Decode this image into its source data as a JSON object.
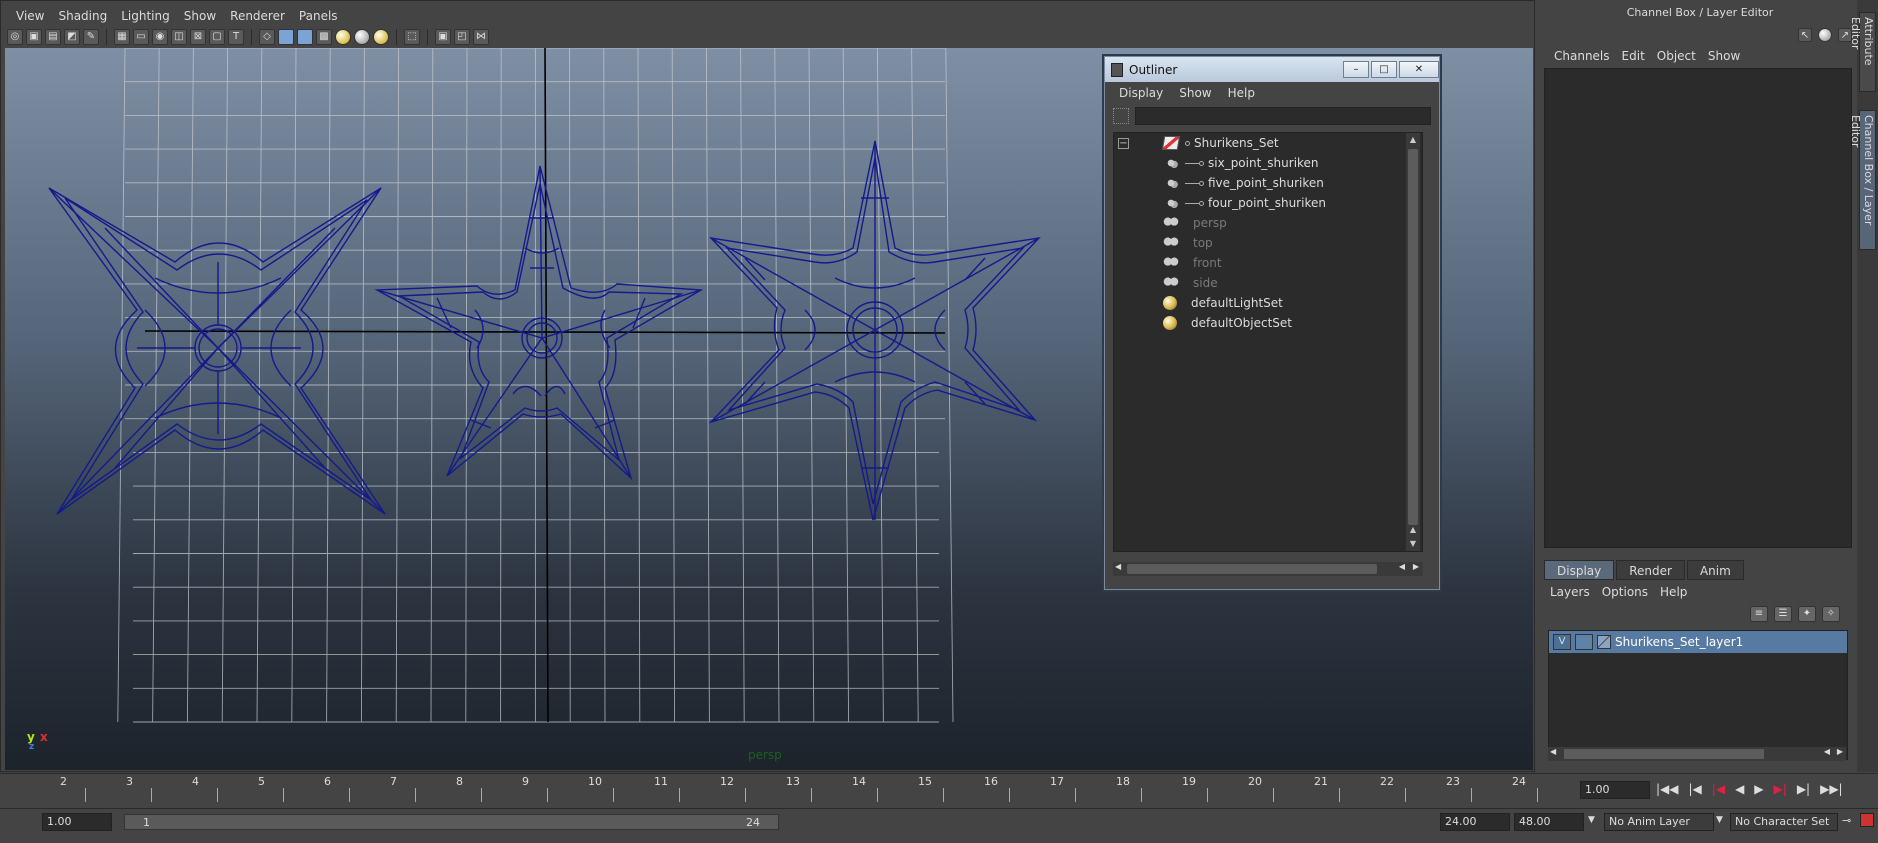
{
  "viewport": {
    "menu": [
      "View",
      "Shading",
      "Lighting",
      "Show",
      "Renderer",
      "Panels"
    ],
    "camera_label": "persp",
    "axis": {
      "y": "y",
      "x": "x",
      "z": "z"
    }
  },
  "outliner": {
    "title": "Outliner",
    "menu": [
      "Display",
      "Show",
      "Help"
    ],
    "filter_value": "",
    "items": [
      {
        "label": "Shurikens_Set",
        "icon": "set-icon",
        "level": 0,
        "expanded": true
      },
      {
        "label": "six_point_shuriken",
        "icon": "mesh-icon",
        "level": 1
      },
      {
        "label": "five_point_shuriken",
        "icon": "mesh-icon",
        "level": 1
      },
      {
        "label": "four_point_shuriken",
        "icon": "mesh-icon",
        "level": 1
      },
      {
        "label": "persp",
        "icon": "camera-icon",
        "level": 0,
        "dim": true
      },
      {
        "label": "top",
        "icon": "camera-icon",
        "level": 0,
        "dim": true
      },
      {
        "label": "front",
        "icon": "camera-icon",
        "level": 0,
        "dim": true
      },
      {
        "label": "side",
        "icon": "camera-icon",
        "level": 0,
        "dim": true
      },
      {
        "label": "defaultLightSet",
        "icon": "light-set-icon",
        "level": 0
      },
      {
        "label": "defaultObjectSet",
        "icon": "object-set-icon",
        "level": 0
      }
    ]
  },
  "channel_box": {
    "title": "Channel Box / Layer Editor",
    "menu": [
      "Channels",
      "Edit",
      "Object",
      "Show"
    ],
    "tabs": [
      "Display",
      "Render",
      "Anim"
    ],
    "layer_menu": [
      "Layers",
      "Options",
      "Help"
    ],
    "layers": [
      {
        "visible": "V",
        "name": "Shurikens_Set_layer1"
      }
    ],
    "side_tabs": [
      "Attribute Editor",
      "Channel Box / Layer Editor"
    ]
  },
  "timeline": {
    "ticks": [
      "2",
      "3",
      "4",
      "5",
      "6",
      "7",
      "8",
      "9",
      "10",
      "11",
      "12",
      "13",
      "14",
      "15",
      "16",
      "17",
      "18",
      "19",
      "20",
      "21",
      "22",
      "23",
      "24"
    ],
    "current_frame": "1.00"
  },
  "range": {
    "start_value": "1.00",
    "slider_start": "1",
    "slider_end": "24",
    "end_value": "24.00",
    "anim_end": "48.00",
    "anim_layer": "No Anim Layer",
    "character_set": "No Character Set"
  },
  "colors": {
    "wireframe": "#141a8c",
    "selected_layer": "#567aa2",
    "accent": "#5a6a7a"
  }
}
